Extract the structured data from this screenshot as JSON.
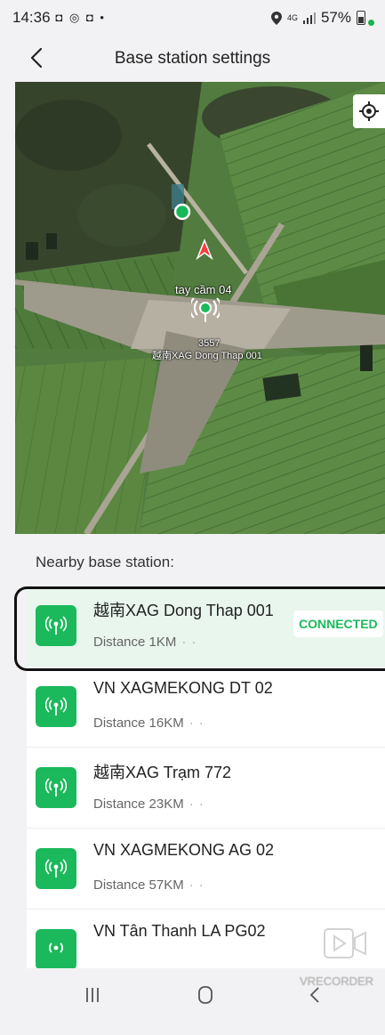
{
  "status_bar": {
    "time": "14:36",
    "left_icons": "◘ ◎ ◘ •",
    "network": "4G",
    "battery_percent": "57%"
  },
  "header": {
    "title": "Base station settings"
  },
  "map": {
    "labels": {
      "device": "tay cầm 04",
      "station_id": "3557",
      "station_name": "越南XAG Dong Thap 001"
    }
  },
  "nearby": {
    "label": "Nearby base station:",
    "stations": [
      {
        "name": "越南XAG Dong Thap 001",
        "distance": "Distance 1KM",
        "status": "CONNECTED"
      },
      {
        "name": "VN XAGMEKONG DT 02",
        "distance": "Distance 16KM",
        "status": ""
      },
      {
        "name": "越南XAG Trạm 772",
        "distance": "Distance 23KM",
        "status": ""
      },
      {
        "name": "VN XAGMEKONG AG 02",
        "distance": "Distance 57KM",
        "status": ""
      },
      {
        "name": "VN Tân Thanh LA PG02",
        "distance": "",
        "status": ""
      }
    ]
  },
  "watermark": {
    "text": "VRECORDER"
  },
  "colors": {
    "accent": "#1bb95b",
    "connected_bg": "#e8f6ee"
  }
}
